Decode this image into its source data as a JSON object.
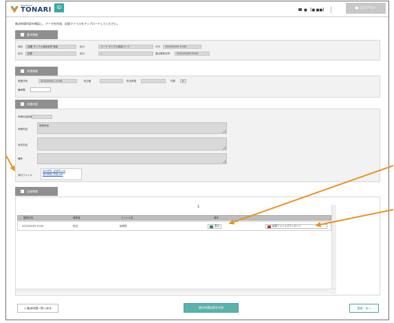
{
  "header": {
    "logo_sub": "NISSHOKU",
    "logo_main": "TONARI",
    "badge": "ID",
    "user": "■ 【■ ■■】",
    "logout": "■ ログアウト"
  },
  "description": "後決申請内容を確認し、データを作成、記録ファイルをアップロードしてください。",
  "section1": {
    "title": "基本情報",
    "row1": [
      {
        "label": "項目",
        "value": "店舗 サンプル商品名称 商品"
      },
      {
        "label": "区分",
        "value": "コード サンプル商品コード"
      },
      {
        "label": "日付",
        "value": "2022/09/05 10:00"
      }
    ],
    "row2": [
      {
        "label": "区分",
        "value": "記録"
      },
      {
        "label": "区分",
        "value": "—"
      },
      {
        "label": "直近更新日時",
        "value": "2022/09/05 09:00"
      }
    ]
  },
  "section2": {
    "title": "申請情報",
    "fields": [
      {
        "label": "実施日時",
        "value": "2022/09/01 10:00"
      },
      {
        "label": "担当者",
        "value": ""
      },
      {
        "label": "担当所属",
        "value": ""
      },
      {
        "label": "件数",
        "value": "0"
      }
    ],
    "input_label": "備考欄"
  },
  "section3": {
    "title": "申請内容",
    "subtitle": "申請内容詳細",
    "rows": [
      {
        "label": "申請内容",
        "value": "申請内容"
      },
      {
        "label": "対応内容",
        "value": ""
      },
      {
        "label": "備考",
        "value": ""
      }
    ],
    "attachment_label": "添付ファイル",
    "attachments": [
      "添付資料_記録書.pdf",
      "添付資料_写真.pdf"
    ]
  },
  "section4": {
    "title": "記録情報",
    "page_marker": "1",
    "columns": [
      "登録日時",
      "登録者",
      "ファイル名",
      "操作"
    ],
    "rows": [
      {
        "date": "2022/09/05 10:00",
        "user": "担当",
        "file": "記録書",
        "view_label": "表示",
        "download_label": "記録ファイルダウンロード"
      }
    ]
  },
  "footer": {
    "back_label": "後決申請一覧へ戻る",
    "create_label": "後決申請記録を作成",
    "next_label": "登録・次へ"
  },
  "colors": {
    "accent": "#3aa6a0",
    "section_header": "#8f8f8f",
    "arrow": "#e8921e",
    "brand_blue": "#1d3d6f"
  }
}
